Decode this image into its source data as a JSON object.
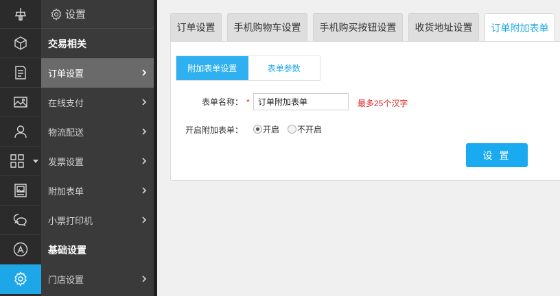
{
  "sidebar": {
    "header": "设置",
    "items": [
      {
        "label": "交易相关",
        "group": true
      },
      {
        "label": "订单设置",
        "active": true
      },
      {
        "label": "在线支付"
      },
      {
        "label": "物流配送"
      },
      {
        "label": "发票设置"
      },
      {
        "label": "附加表单"
      },
      {
        "label": "小票打印机"
      },
      {
        "label": "基础设置",
        "group": true
      },
      {
        "label": "门店设置"
      }
    ]
  },
  "tabs": [
    {
      "label": "订单设置"
    },
    {
      "label": "手机购物车设置"
    },
    {
      "label": "手机购买按钮设置"
    },
    {
      "label": "收货地址设置"
    },
    {
      "label": "订单附加表单",
      "active": true
    }
  ],
  "subtabs": [
    {
      "label": "附加表单设置",
      "active": true
    },
    {
      "label": "表单参数"
    }
  ],
  "form": {
    "name_label": "表单名称：",
    "required_mark": "*",
    "name_value": "订单附加表单",
    "name_hint": "最多25个汉字",
    "enable_label": "开启附加表单：",
    "option_on": "开启",
    "option_off": "不开启",
    "enabled": true,
    "submit_label": "设 置"
  },
  "colors": {
    "accent": "#1ea7e8",
    "hint": "#dd2222",
    "rail_bg": "#2b2b2b",
    "sidebar_bg": "#3a3a3a"
  },
  "icons": {
    "rail": [
      "logo-icon",
      "cube-icon",
      "order-doc-icon",
      "image-icon",
      "user-icon",
      "grid-icon",
      "picture-frame-icon",
      "wechat-icon",
      "app-store-icon",
      "gear-icon"
    ]
  }
}
